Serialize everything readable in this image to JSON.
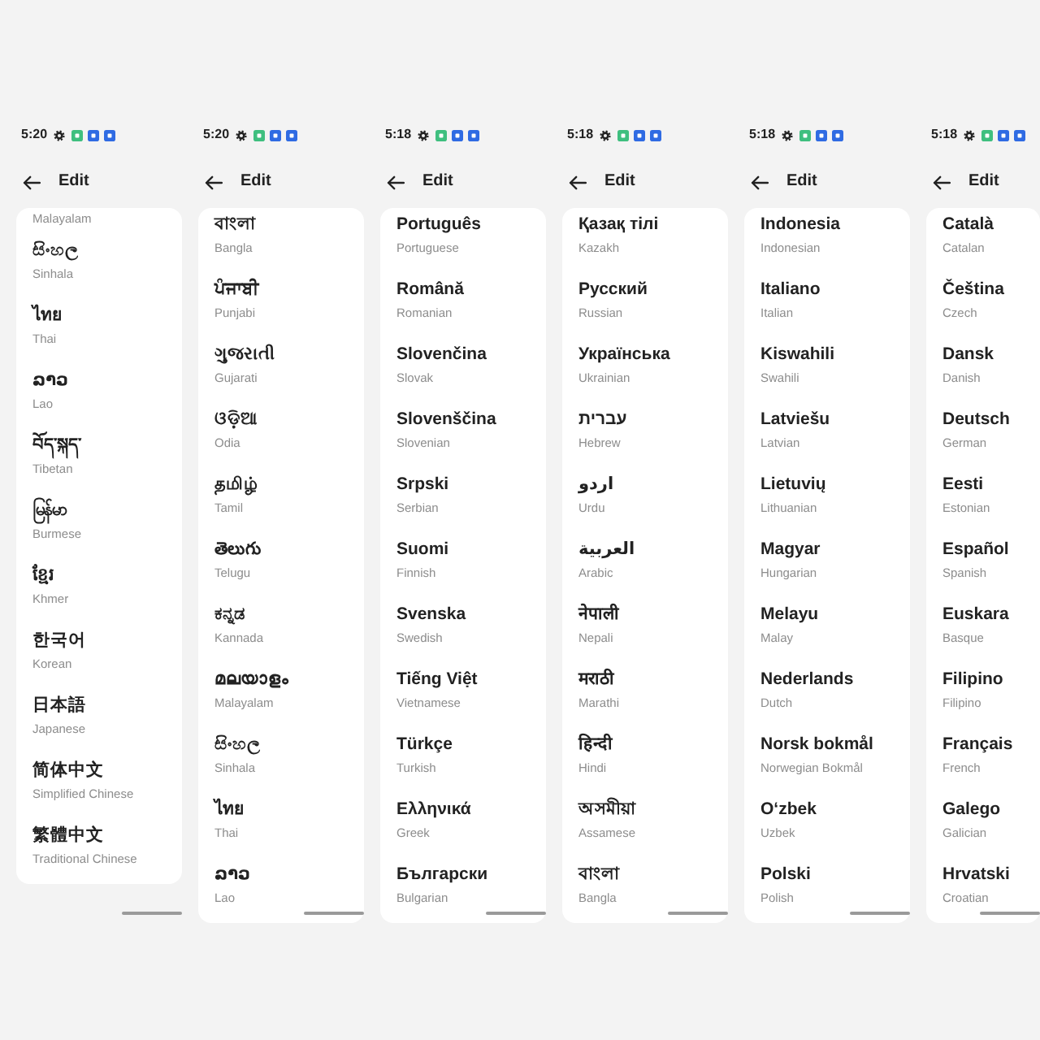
{
  "screens": [
    {
      "time": "5:20",
      "notification_icons": [
        {
          "color": "#3fbf7f"
        },
        {
          "color": "#2f6be3"
        },
        {
          "color": "#2f6be3"
        }
      ],
      "title": "Edit",
      "languages": [
        {
          "english": "Malayalam"
        },
        {
          "native": "සිංහල",
          "english": "Sinhala"
        },
        {
          "native": "ไทย",
          "english": "Thai"
        },
        {
          "native": "ລາວ",
          "english": "Lao"
        },
        {
          "native": "བོད་སྐད་",
          "english": "Tibetan"
        },
        {
          "native": "မြန်မာ",
          "english": "Burmese"
        },
        {
          "native": "ខ្មែរ",
          "english": "Khmer"
        },
        {
          "native": "한국어",
          "english": "Korean"
        },
        {
          "native": "日本語",
          "english": "Japanese"
        },
        {
          "native": "简体中文",
          "english": "Simplified Chinese"
        },
        {
          "native": "繁體中文",
          "english": "Traditional Chinese"
        }
      ]
    },
    {
      "time": "5:20",
      "notification_icons": [
        {
          "color": "#3fbf7f"
        },
        {
          "color": "#2f6be3"
        },
        {
          "color": "#2f6be3"
        }
      ],
      "title": "Edit",
      "languages": [
        {
          "native": "বাংলা",
          "english": "Bangla"
        },
        {
          "native": "ਪੰਜਾਬੀ",
          "english": "Punjabi"
        },
        {
          "native": "ગુજરાતી",
          "english": "Gujarati"
        },
        {
          "native": "ଓଡ଼ିଆ",
          "english": "Odia"
        },
        {
          "native": "தமிழ்",
          "english": "Tamil"
        },
        {
          "native": "తెలుగు",
          "english": "Telugu"
        },
        {
          "native": "ಕನ್ನಡ",
          "english": "Kannada"
        },
        {
          "native": "മലയാളം",
          "english": "Malayalam"
        },
        {
          "native": "සිංහල",
          "english": "Sinhala"
        },
        {
          "native": "ไทย",
          "english": "Thai"
        },
        {
          "native": "ລາວ",
          "english": "Lao"
        }
      ]
    },
    {
      "time": "5:18",
      "notification_icons": [
        {
          "color": "#3fbf7f"
        },
        {
          "color": "#2f6be3"
        },
        {
          "color": "#2f6be3"
        }
      ],
      "title": "Edit",
      "languages": [
        {
          "native": "Português",
          "english": "Portuguese"
        },
        {
          "native": "Română",
          "english": "Romanian"
        },
        {
          "native": "Slovenčina",
          "english": "Slovak"
        },
        {
          "native": "Slovenščina",
          "english": "Slovenian"
        },
        {
          "native": "Srpski",
          "english": "Serbian"
        },
        {
          "native": "Suomi",
          "english": "Finnish"
        },
        {
          "native": "Svenska",
          "english": "Swedish"
        },
        {
          "native": "Tiếng Việt",
          "english": "Vietnamese"
        },
        {
          "native": "Türkçe",
          "english": "Turkish"
        },
        {
          "native": "Ελληνικά",
          "english": "Greek"
        },
        {
          "native": "Български",
          "english": "Bulgarian"
        }
      ]
    },
    {
      "time": "5:18",
      "notification_icons": [
        {
          "color": "#3fbf7f"
        },
        {
          "color": "#2f6be3"
        },
        {
          "color": "#2f6be3"
        }
      ],
      "title": "Edit",
      "languages": [
        {
          "native": "Қазақ тілі",
          "english": "Kazakh"
        },
        {
          "native": "Русский",
          "english": "Russian"
        },
        {
          "native": "Українська",
          "english": "Ukrainian"
        },
        {
          "native": "עברית",
          "english": "Hebrew"
        },
        {
          "native": "اردو",
          "english": "Urdu"
        },
        {
          "native": "العربية",
          "english": "Arabic"
        },
        {
          "native": "नेपाली",
          "english": "Nepali"
        },
        {
          "native": "मराठी",
          "english": "Marathi"
        },
        {
          "native": "हिन्दी",
          "english": "Hindi"
        },
        {
          "native": "অসমীয়া",
          "english": "Assamese"
        },
        {
          "native": "বাংলা",
          "english": "Bangla"
        }
      ]
    },
    {
      "time": "5:18",
      "notification_icons": [
        {
          "color": "#3fbf7f"
        },
        {
          "color": "#2f6be3"
        },
        {
          "color": "#2f6be3"
        }
      ],
      "title": "Edit",
      "languages": [
        {
          "native": "Indonesia",
          "english": "Indonesian"
        },
        {
          "native": "Italiano",
          "english": "Italian"
        },
        {
          "native": "Kiswahili",
          "english": "Swahili"
        },
        {
          "native": "Latviešu",
          "english": "Latvian"
        },
        {
          "native": "Lietuvių",
          "english": "Lithuanian"
        },
        {
          "native": "Magyar",
          "english": "Hungarian"
        },
        {
          "native": "Melayu",
          "english": "Malay"
        },
        {
          "native": "Nederlands",
          "english": "Dutch"
        },
        {
          "native": "Norsk bokmål",
          "english": "Norwegian Bokmål"
        },
        {
          "native": "O‘zbek",
          "english": "Uzbek"
        },
        {
          "native": "Polski",
          "english": "Polish"
        }
      ]
    },
    {
      "time": "5:18",
      "notification_icons": [
        {
          "color": "#3fbf7f"
        },
        {
          "color": "#2f6be3"
        },
        {
          "color": "#2f6be3"
        }
      ],
      "title": "Edit",
      "languages": [
        {
          "native": "Català",
          "english": "Catalan"
        },
        {
          "native": "Čeština",
          "english": "Czech"
        },
        {
          "native": "Dansk",
          "english": "Danish"
        },
        {
          "native": "Deutsch",
          "english": "German"
        },
        {
          "native": "Eesti",
          "english": "Estonian"
        },
        {
          "native": "Español",
          "english": "Spanish"
        },
        {
          "native": "Euskara",
          "english": "Basque"
        },
        {
          "native": "Filipino",
          "english": "Filipino"
        },
        {
          "native": "Français",
          "english": "French"
        },
        {
          "native": "Galego",
          "english": "Galician"
        },
        {
          "native": "Hrvatski",
          "english": "Croatian"
        }
      ]
    }
  ]
}
